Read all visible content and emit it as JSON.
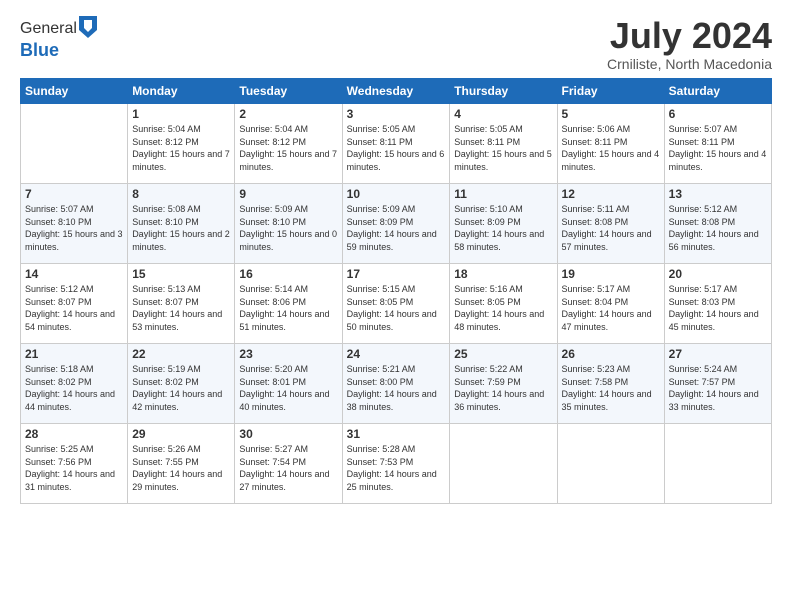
{
  "header": {
    "logo_line1": "General",
    "logo_line2": "Blue",
    "month_year": "July 2024",
    "location": "Crniliste, North Macedonia"
  },
  "weekdays": [
    "Sunday",
    "Monday",
    "Tuesday",
    "Wednesday",
    "Thursday",
    "Friday",
    "Saturday"
  ],
  "weeks": [
    [
      {
        "day": "",
        "sunrise": "",
        "sunset": "",
        "daylight": ""
      },
      {
        "day": "1",
        "sunrise": "5:04 AM",
        "sunset": "8:12 PM",
        "daylight": "15 hours and 7 minutes."
      },
      {
        "day": "2",
        "sunrise": "5:04 AM",
        "sunset": "8:12 PM",
        "daylight": "15 hours and 7 minutes."
      },
      {
        "day": "3",
        "sunrise": "5:05 AM",
        "sunset": "8:11 PM",
        "daylight": "15 hours and 6 minutes."
      },
      {
        "day": "4",
        "sunrise": "5:05 AM",
        "sunset": "8:11 PM",
        "daylight": "15 hours and 5 minutes."
      },
      {
        "day": "5",
        "sunrise": "5:06 AM",
        "sunset": "8:11 PM",
        "daylight": "15 hours and 4 minutes."
      },
      {
        "day": "6",
        "sunrise": "5:07 AM",
        "sunset": "8:11 PM",
        "daylight": "15 hours and 4 minutes."
      }
    ],
    [
      {
        "day": "7",
        "sunrise": "5:07 AM",
        "sunset": "8:10 PM",
        "daylight": "15 hours and 3 minutes."
      },
      {
        "day": "8",
        "sunrise": "5:08 AM",
        "sunset": "8:10 PM",
        "daylight": "15 hours and 2 minutes."
      },
      {
        "day": "9",
        "sunrise": "5:09 AM",
        "sunset": "8:10 PM",
        "daylight": "15 hours and 0 minutes."
      },
      {
        "day": "10",
        "sunrise": "5:09 AM",
        "sunset": "8:09 PM",
        "daylight": "14 hours and 59 minutes."
      },
      {
        "day": "11",
        "sunrise": "5:10 AM",
        "sunset": "8:09 PM",
        "daylight": "14 hours and 58 minutes."
      },
      {
        "day": "12",
        "sunrise": "5:11 AM",
        "sunset": "8:08 PM",
        "daylight": "14 hours and 57 minutes."
      },
      {
        "day": "13",
        "sunrise": "5:12 AM",
        "sunset": "8:08 PM",
        "daylight": "14 hours and 56 minutes."
      }
    ],
    [
      {
        "day": "14",
        "sunrise": "5:12 AM",
        "sunset": "8:07 PM",
        "daylight": "14 hours and 54 minutes."
      },
      {
        "day": "15",
        "sunrise": "5:13 AM",
        "sunset": "8:07 PM",
        "daylight": "14 hours and 53 minutes."
      },
      {
        "day": "16",
        "sunrise": "5:14 AM",
        "sunset": "8:06 PM",
        "daylight": "14 hours and 51 minutes."
      },
      {
        "day": "17",
        "sunrise": "5:15 AM",
        "sunset": "8:05 PM",
        "daylight": "14 hours and 50 minutes."
      },
      {
        "day": "18",
        "sunrise": "5:16 AM",
        "sunset": "8:05 PM",
        "daylight": "14 hours and 48 minutes."
      },
      {
        "day": "19",
        "sunrise": "5:17 AM",
        "sunset": "8:04 PM",
        "daylight": "14 hours and 47 minutes."
      },
      {
        "day": "20",
        "sunrise": "5:17 AM",
        "sunset": "8:03 PM",
        "daylight": "14 hours and 45 minutes."
      }
    ],
    [
      {
        "day": "21",
        "sunrise": "5:18 AM",
        "sunset": "8:02 PM",
        "daylight": "14 hours and 44 minutes."
      },
      {
        "day": "22",
        "sunrise": "5:19 AM",
        "sunset": "8:02 PM",
        "daylight": "14 hours and 42 minutes."
      },
      {
        "day": "23",
        "sunrise": "5:20 AM",
        "sunset": "8:01 PM",
        "daylight": "14 hours and 40 minutes."
      },
      {
        "day": "24",
        "sunrise": "5:21 AM",
        "sunset": "8:00 PM",
        "daylight": "14 hours and 38 minutes."
      },
      {
        "day": "25",
        "sunrise": "5:22 AM",
        "sunset": "7:59 PM",
        "daylight": "14 hours and 36 minutes."
      },
      {
        "day": "26",
        "sunrise": "5:23 AM",
        "sunset": "7:58 PM",
        "daylight": "14 hours and 35 minutes."
      },
      {
        "day": "27",
        "sunrise": "5:24 AM",
        "sunset": "7:57 PM",
        "daylight": "14 hours and 33 minutes."
      }
    ],
    [
      {
        "day": "28",
        "sunrise": "5:25 AM",
        "sunset": "7:56 PM",
        "daylight": "14 hours and 31 minutes."
      },
      {
        "day": "29",
        "sunrise": "5:26 AM",
        "sunset": "7:55 PM",
        "daylight": "14 hours and 29 minutes."
      },
      {
        "day": "30",
        "sunrise": "5:27 AM",
        "sunset": "7:54 PM",
        "daylight": "14 hours and 27 minutes."
      },
      {
        "day": "31",
        "sunrise": "5:28 AM",
        "sunset": "7:53 PM",
        "daylight": "14 hours and 25 minutes."
      },
      {
        "day": "",
        "sunrise": "",
        "sunset": "",
        "daylight": ""
      },
      {
        "day": "",
        "sunrise": "",
        "sunset": "",
        "daylight": ""
      },
      {
        "day": "",
        "sunrise": "",
        "sunset": "",
        "daylight": ""
      }
    ]
  ],
  "labels": {
    "sunrise": "Sunrise:",
    "sunset": "Sunset:",
    "daylight": "Daylight:"
  }
}
